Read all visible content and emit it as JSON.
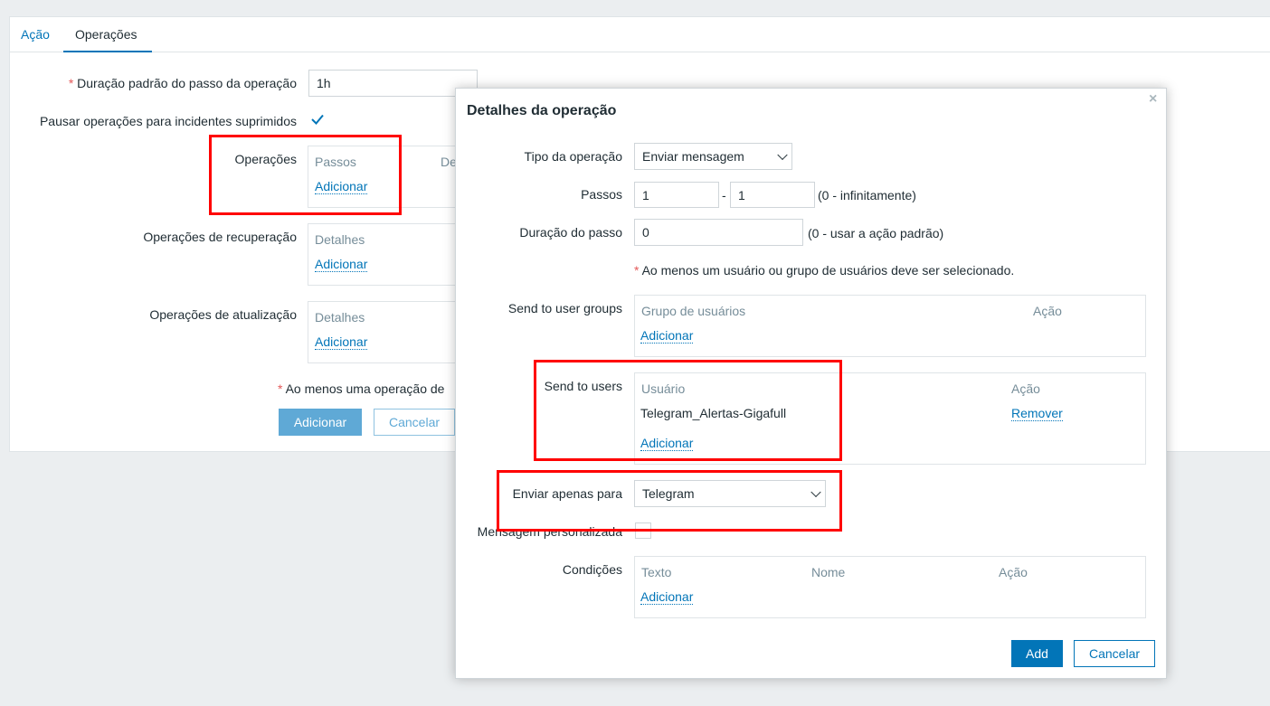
{
  "tabs": {
    "acao": "Ação",
    "operacoes": "Operações"
  },
  "form": {
    "duracao_label": "Duração padrão do passo da operação",
    "duracao_value": "1h",
    "pausar_label": "Pausar operações para incidentes suprimidos",
    "pausar_checked": true,
    "operacoes_label": "Operações",
    "operacoes_col1": "Passos",
    "operacoes_col2_partial": "De",
    "recuperacao_label": "Operações de recuperação",
    "atualizacao_label": "Operações de atualização",
    "detalhes_col": "Detalhes",
    "adicionar_link": "Adicionar",
    "required_note_partial": "Ao menos uma operação de",
    "add_button": "Adicionar",
    "cancel_button": "Cancelar"
  },
  "dialog": {
    "title": "Detalhes da operação",
    "close": "×",
    "tipo_label": "Tipo da operação",
    "tipo_value": "Enviar mensagem",
    "passos_label": "Passos",
    "passos_from": "1",
    "passos_sep": "-",
    "passos_to": "1",
    "passos_hint": "(0 - infinitamente)",
    "duracao_label": "Duração do passo",
    "duracao_value": "0",
    "duracao_hint": "(0 - usar a ação padrão)",
    "required_note": "Ao menos um usuário ou grupo de usuários deve ser selecionado.",
    "user_groups_label": "Send to user groups",
    "user_groups_col1": "Grupo de usuários",
    "user_groups_col2": "Ação",
    "users_label": "Send to users",
    "users_col1": "Usuário",
    "users_col2": "Ação",
    "users_rows": [
      {
        "name": "Telegram_Alertas-Gigafull",
        "action": "Remover"
      }
    ],
    "enviar_label": "Enviar apenas para",
    "enviar_value": "Telegram",
    "mensagem_label": "Mensagem personalizada",
    "condicoes_label": "Condições",
    "condicoes_col1": "Texto",
    "condicoes_col2": "Nome",
    "condicoes_col3": "Ação",
    "adicionar_link": "Adicionar",
    "add_button": "Add",
    "cancel_button": "Cancelar"
  },
  "colors": {
    "accent": "#0275b8",
    "highlight": "#ff0000",
    "required": "#e45959"
  }
}
